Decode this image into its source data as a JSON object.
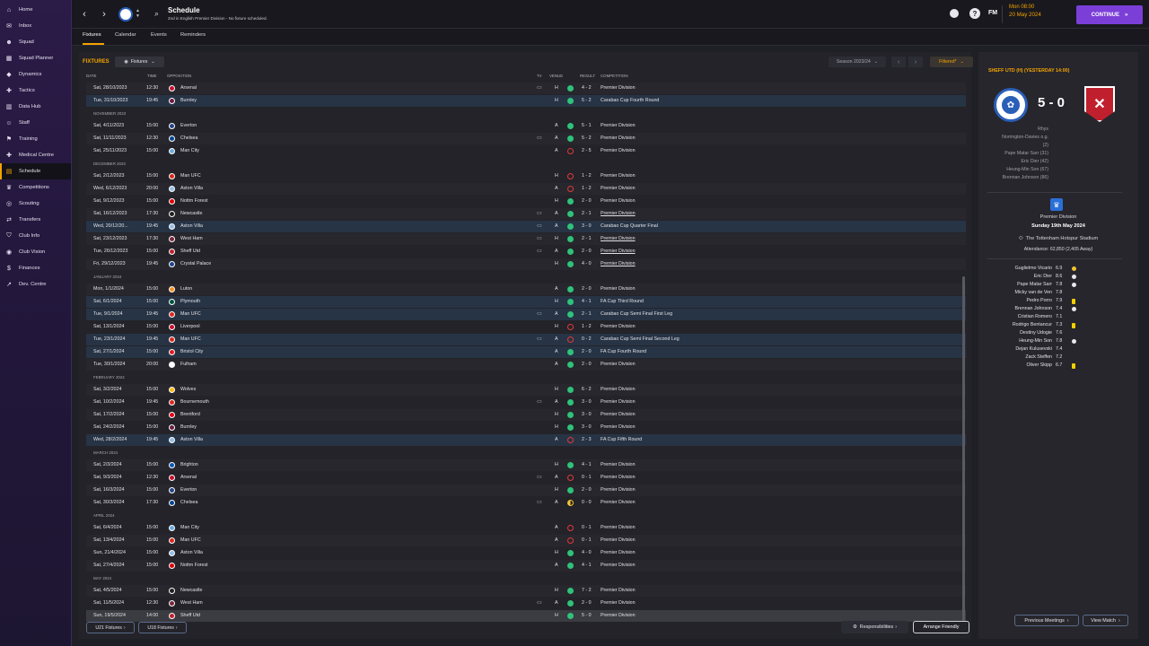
{
  "sidebar": [
    {
      "label": "Home",
      "icon": "⌂"
    },
    {
      "label": "Inbox",
      "icon": "✉"
    },
    {
      "label": "Squad",
      "icon": "☻"
    },
    {
      "label": "Squad Planner",
      "icon": "▦"
    },
    {
      "label": "Dynamics",
      "icon": "◆"
    },
    {
      "label": "Tactics",
      "icon": "✚"
    },
    {
      "label": "Data Hub",
      "icon": "▥"
    },
    {
      "label": "Staff",
      "icon": "☺"
    },
    {
      "label": "Training",
      "icon": "⚑"
    },
    {
      "label": "Medical Centre",
      "icon": "✚"
    },
    {
      "label": "Schedule",
      "icon": "▤",
      "active": true
    },
    {
      "label": "Competitions",
      "icon": "♛"
    },
    {
      "label": "Scouting",
      "icon": "◎"
    },
    {
      "label": "Transfers",
      "icon": "⇄"
    },
    {
      "label": "Club Info",
      "icon": "⛉"
    },
    {
      "label": "Club Vision",
      "icon": "◉"
    },
    {
      "label": "Finances",
      "icon": "$"
    },
    {
      "label": "Dev. Centre",
      "icon": "↗"
    }
  ],
  "topbar": {
    "title": "Schedule",
    "subtitle": "2nd in English Premier Division - No fixture scheduled.",
    "date_line1": "Mon 08:00",
    "date_line2": "20 May 2024",
    "continue_label": "CONTINUE",
    "fm_label": "FM",
    "help_label": "?"
  },
  "tabs": [
    "Fixtures",
    "Calendar",
    "Events",
    "Reminders"
  ],
  "toolbar": {
    "fixtures_title": "FIXTURES",
    "fixtures_dd": "Fixtures",
    "season": "Season 2023/24",
    "filtered": "Filtered*"
  },
  "columns": {
    "date": "DATE",
    "time": "TIME",
    "opposition": "OPPOSITION",
    "tv": "TV",
    "venue": "VENUE",
    "result": "RESULT",
    "competition": "COMPETITION"
  },
  "fixtures": [
    {
      "date": "Sat, 28/10/2023",
      "time": "12:30",
      "opp": "Arsenal",
      "tv": true,
      "venue": "H",
      "res": "W",
      "score": "4 - 2",
      "comp": "Premier Division",
      "badge": "#c8102e"
    },
    {
      "date": "Tue, 31/10/2023",
      "time": "19:45",
      "opp": "Burnley",
      "venue": "H",
      "res": "W",
      "score": "5 - 2",
      "comp": "Carabao Cup Fourth Round",
      "cup": true,
      "badge": "#6c1d45"
    },
    {
      "month": "NOVEMBER 2023"
    },
    {
      "date": "Sat, 4/11/2023",
      "time": "15:00",
      "opp": "Everton",
      "venue": "A",
      "res": "W",
      "score": "5 - 1",
      "comp": "Premier Division",
      "badge": "#274488"
    },
    {
      "date": "Sat, 11/11/2023",
      "time": "12:30",
      "opp": "Chelsea",
      "tv": true,
      "venue": "A",
      "res": "W",
      "score": "5 - 2",
      "comp": "Premier Division",
      "badge": "#034694"
    },
    {
      "date": "Sat, 25/11/2023",
      "time": "15:00",
      "opp": "Man City",
      "venue": "A",
      "res": "L",
      "score": "2 - 5",
      "comp": "Premier Division",
      "badge": "#6cabdd"
    },
    {
      "month": "DECEMBER 2023"
    },
    {
      "date": "Sat, 2/12/2023",
      "time": "15:00",
      "opp": "Man UFC",
      "venue": "H",
      "res": "L",
      "score": "1 - 2",
      "comp": "Premier Division",
      "badge": "#da291c"
    },
    {
      "date": "Wed, 6/12/2023",
      "time": "20:00",
      "opp": "Aston Villa",
      "venue": "A",
      "res": "L",
      "score": "1 - 2",
      "comp": "Premier Division",
      "badge": "#95bfe5"
    },
    {
      "date": "Sat, 9/12/2023",
      "time": "15:00",
      "opp": "Nottm Forest",
      "venue": "H",
      "res": "W",
      "score": "2 - 0",
      "comp": "Premier Division",
      "badge": "#dd0000"
    },
    {
      "date": "Sat, 16/12/2023",
      "time": "17:30",
      "opp": "Newcastle",
      "tv": true,
      "venue": "A",
      "res": "W",
      "score": "2 - 1",
      "comp": "Premier Division",
      "ul": true,
      "badge": "#241f20"
    },
    {
      "date": "Wed, 20/12/20...",
      "time": "19:45",
      "opp": "Aston Villa",
      "tv": true,
      "venue": "A",
      "res": "W",
      "score": "3 - 0",
      "comp": "Carabao Cup Quarter Final",
      "cup": true,
      "badge": "#95bfe5"
    },
    {
      "date": "Sat, 23/12/2023",
      "time": "17:30",
      "opp": "West Ham",
      "tv": true,
      "venue": "H",
      "res": "W",
      "score": "2 - 1",
      "comp": "Premier Division",
      "ul": true,
      "badge": "#7a263a"
    },
    {
      "date": "Tue, 26/12/2023",
      "time": "15:00",
      "opp": "Sheff Utd",
      "tv": true,
      "venue": "A",
      "res": "W",
      "score": "2 - 0",
      "comp": "Premier Division",
      "ul": true,
      "badge": "#c0202e"
    },
    {
      "date": "Fri, 29/12/2023",
      "time": "19:45",
      "opp": "Crystal Palace",
      "venue": "H",
      "res": "W",
      "score": "4 - 0",
      "comp": "Premier Division",
      "ul": true,
      "badge": "#1b458f"
    },
    {
      "month": "JANUARY 2024"
    },
    {
      "date": "Mon, 1/1/2024",
      "time": "15:00",
      "opp": "Luton",
      "venue": "A",
      "res": "W",
      "score": "2 - 0",
      "comp": "Premier Division",
      "badge": "#f78f1e"
    },
    {
      "date": "Sat, 6/1/2024",
      "time": "15:00",
      "opp": "Plymouth",
      "venue": "H",
      "res": "W",
      "score": "4 - 1",
      "comp": "FA Cup Third Round",
      "cup": true,
      "badge": "#00563f"
    },
    {
      "date": "Tue, 9/1/2024",
      "time": "19:45",
      "opp": "Man UFC",
      "tv": true,
      "venue": "A",
      "res": "W",
      "score": "2 - 1",
      "comp": "Carabao Cup Semi Final First Leg",
      "cup": true,
      "badge": "#da291c"
    },
    {
      "date": "Sat, 13/1/2024",
      "time": "15:00",
      "opp": "Liverpool",
      "venue": "H",
      "res": "L",
      "score": "1 - 2",
      "comp": "Premier Division",
      "badge": "#c8102e"
    },
    {
      "date": "Tue, 23/1/2024",
      "time": "19:45",
      "opp": "Man UFC",
      "tv": true,
      "venue": "A",
      "res": "L",
      "score": "0 - 2",
      "comp": "Carabao Cup Semi Final Second Leg",
      "cup": true,
      "badge": "#da291c"
    },
    {
      "date": "Sat, 27/1/2024",
      "time": "15:00",
      "opp": "Bristol City",
      "venue": "A",
      "res": "W",
      "score": "2 - 0",
      "comp": "FA Cup Fourth Round",
      "cup": true,
      "badge": "#e21a23"
    },
    {
      "date": "Tue, 30/1/2024",
      "time": "20:00",
      "opp": "Fulham",
      "venue": "A",
      "res": "W",
      "score": "2 - 0",
      "comp": "Premier Division",
      "badge": "#ffffff"
    },
    {
      "month": "FEBRUARY 2024"
    },
    {
      "date": "Sat, 3/2/2024",
      "time": "15:00",
      "opp": "Wolves",
      "venue": "H",
      "res": "W",
      "score": "6 - 2",
      "comp": "Premier Division",
      "badge": "#fdb913"
    },
    {
      "date": "Sat, 10/2/2024",
      "time": "19:45",
      "opp": "Bournemouth",
      "tv": true,
      "venue": "A",
      "res": "W",
      "score": "3 - 0",
      "comp": "Premier Division",
      "badge": "#da291c"
    },
    {
      "date": "Sat, 17/2/2024",
      "time": "15:00",
      "opp": "Brentford",
      "venue": "H",
      "res": "W",
      "score": "3 - 0",
      "comp": "Premier Division",
      "badge": "#e30613"
    },
    {
      "date": "Sat, 24/2/2024",
      "time": "15:00",
      "opp": "Burnley",
      "venue": "H",
      "res": "W",
      "score": "3 - 0",
      "comp": "Premier Division",
      "badge": "#6c1d45"
    },
    {
      "date": "Wed, 28/2/2024",
      "time": "19:45",
      "opp": "Aston Villa",
      "venue": "A",
      "res": "L",
      "score": "2 - 3",
      "comp": "FA Cup Fifth Round",
      "cup": true,
      "badge": "#95bfe5"
    },
    {
      "month": "MARCH 2024"
    },
    {
      "date": "Sat, 2/3/2024",
      "time": "15:00",
      "opp": "Brighton",
      "venue": "H",
      "res": "W",
      "score": "4 - 1",
      "comp": "Premier Division",
      "badge": "#0057b8"
    },
    {
      "date": "Sat, 9/3/2024",
      "time": "12:30",
      "opp": "Arsenal",
      "tv": true,
      "venue": "A",
      "res": "L",
      "score": "0 - 1",
      "comp": "Premier Division",
      "badge": "#c8102e"
    },
    {
      "date": "Sat, 16/3/2024",
      "time": "15:00",
      "opp": "Everton",
      "venue": "H",
      "res": "W",
      "score": "2 - 0",
      "comp": "Premier Division",
      "badge": "#274488"
    },
    {
      "date": "Sat, 30/3/2024",
      "time": "17:30",
      "opp": "Chelsea",
      "tv": true,
      "venue": "A",
      "res": "D",
      "score": "0 - 0",
      "comp": "Premier Division",
      "badge": "#034694"
    },
    {
      "month": "APRIL 2024"
    },
    {
      "date": "Sat, 6/4/2024",
      "time": "15:00",
      "opp": "Man City",
      "venue": "A",
      "res": "L",
      "score": "0 - 1",
      "comp": "Premier Division",
      "badge": "#6cabdd"
    },
    {
      "date": "Sat, 13/4/2024",
      "time": "15:00",
      "opp": "Man UFC",
      "venue": "A",
      "res": "L",
      "score": "0 - 1",
      "comp": "Premier Division",
      "badge": "#da291c"
    },
    {
      "date": "Sun, 21/4/2024",
      "time": "15:00",
      "opp": "Aston Villa",
      "venue": "H",
      "res": "W",
      "score": "4 - 0",
      "comp": "Premier Division",
      "badge": "#95bfe5"
    },
    {
      "date": "Sat, 27/4/2024",
      "time": "15:00",
      "opp": "Nottm Forest",
      "venue": "A",
      "res": "W",
      "score": "4 - 1",
      "comp": "Premier Division",
      "badge": "#dd0000"
    },
    {
      "month": "MAY 2024"
    },
    {
      "date": "Sat, 4/5/2024",
      "time": "15:00",
      "opp": "Newcastle",
      "venue": "H",
      "res": "W",
      "score": "7 - 2",
      "comp": "Premier Division",
      "badge": "#241f20"
    },
    {
      "date": "Sat, 11/5/2024",
      "time": "12:30",
      "opp": "West Ham",
      "tv": true,
      "venue": "A",
      "res": "W",
      "score": "2 - 0",
      "comp": "Premier Division",
      "badge": "#7a263a"
    },
    {
      "date": "Sun, 19/5/2024",
      "time": "14:00",
      "opp": "Sheff Utd",
      "venue": "H",
      "res": "W",
      "score": "5 - 0",
      "comp": "Premier Division",
      "current": true,
      "badge": "#c0202e"
    }
  ],
  "footer": {
    "u21": "U21 Fixtures",
    "u18": "U18 Fixtures",
    "responsibilities": "Responsibilities",
    "arrange": "Arrange Friendly"
  },
  "panel": {
    "title": "SHEFF UTD (H) (YESTERDAY 14:00)",
    "score": "5 - 0",
    "scorers": [
      "Rhys",
      "Norrington-Davies o.g.",
      "(2)",
      "Pape Matar Sarr (31)",
      "Eric Dier (42)",
      "Heung-Min Son (67)",
      "Brennan Johnson (86)"
    ],
    "competition": "Premier Division",
    "match_date": "Sunday 19th May 2024",
    "stadium": "The Tottenham Hotspur Stadium",
    "attendance": "Attendance: 62,850 (2,405 Away)",
    "ratings": [
      {
        "name": "Guglielmo Vicario",
        "score": "6.9",
        "ev": "star"
      },
      {
        "name": "Eric Dier",
        "score": "8.6",
        "ev": "goal"
      },
      {
        "name": "Pape Matar Sarr",
        "score": "7.8",
        "ev": "goal"
      },
      {
        "name": "Micky van de Ven",
        "score": "7.8",
        "ev": ""
      },
      {
        "name": "Pedro Porro",
        "score": "7.9",
        "ev": "yc"
      },
      {
        "name": "Brennan Johnson",
        "score": "7.4",
        "ev": "goal"
      },
      {
        "name": "Cristian Romero",
        "score": "7.1",
        "ev": ""
      },
      {
        "name": "Rodrigo Bentancur",
        "score": "7.3",
        "ev": "yc"
      },
      {
        "name": "Destiny Udogie",
        "score": "7.6",
        "ev": ""
      },
      {
        "name": "Heung-Min Son",
        "score": "7.8",
        "ev": "goal"
      },
      {
        "name": "Dejan Kulusevski",
        "score": "7.4",
        "ev": ""
      },
      {
        "name": "Zack Steffen",
        "score": "7.2",
        "ev": ""
      },
      {
        "name": "Oliver Skipp",
        "score": "6.7",
        "ev": "yc"
      }
    ],
    "prev_btn": "Previous Meetings",
    "view_btn": "View Match"
  }
}
